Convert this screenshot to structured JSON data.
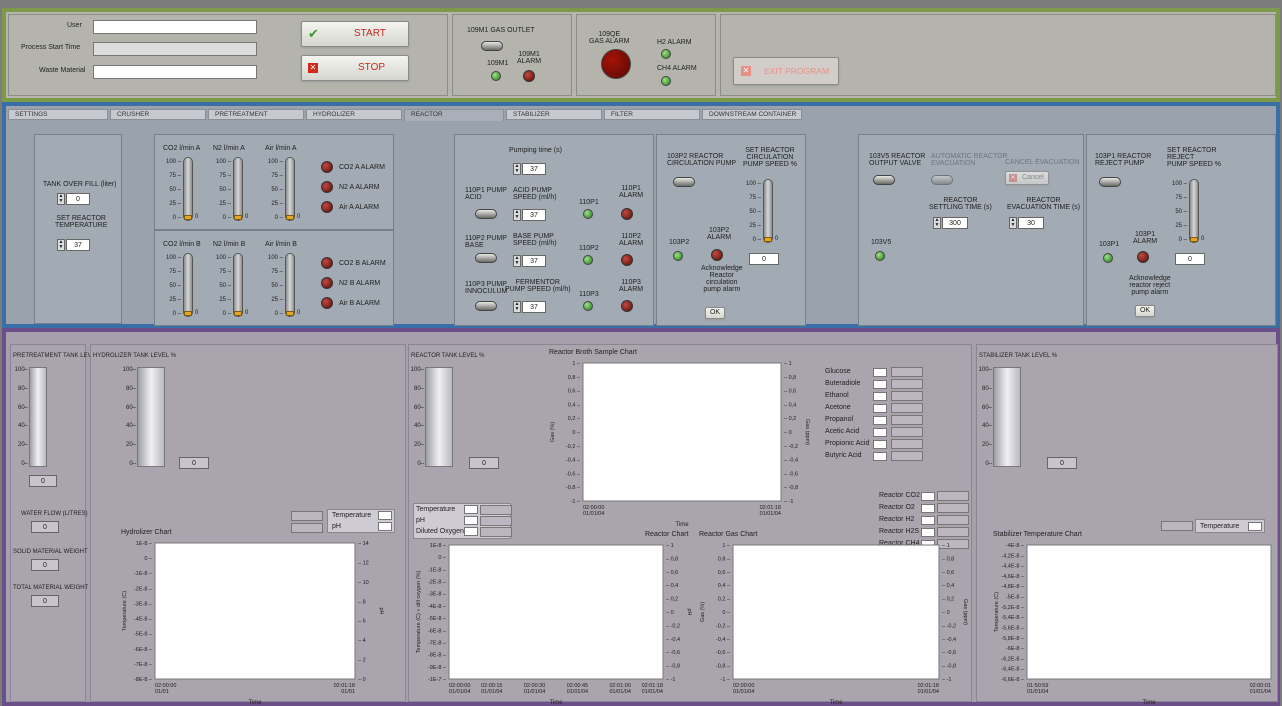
{
  "top": {
    "user_label": "User",
    "start_time_label": "Process Start Time",
    "waste_label": "Waste Material",
    "start": "START",
    "stop": "STOP",
    "gas_outlet": "109M1 GAS OUTLET",
    "m1": "109M1",
    "m1_alarm_a": "109M1",
    "m1_alarm_b": "ALARM",
    "qe_a": "109QE",
    "qe_b": "GAS ALARM",
    "h2_alarm": "H2 ALARM",
    "ch4_alarm": "CH4 ALARM",
    "exit": "EXIT PROGRAM"
  },
  "tabs": [
    "SETTINGS",
    "CRUSHER",
    "PRETREATMENT",
    "HYDROLIZER",
    "REACTOR",
    "STABILIZER",
    "FILTER",
    "DOWNSTREAM CONTAINER"
  ],
  "reactor": {
    "overfill_label": "TANK OVER FILL (liter)",
    "overfill": "0",
    "set_temp_a": "SET REACTOR",
    "set_temp_b": "TEMPERATURE",
    "set_temp": "37",
    "co2a": "CO2 l/min A",
    "n2a": "N2 l/min A",
    "aira": "Air l/min A",
    "co2b": "CO2 l/min B",
    "n2b": "N2 l/min B",
    "airb": "Air l/min B",
    "gauge_ticks": [
      "100",
      "75",
      "50",
      "25",
      "0"
    ],
    "gauge_zero": "0",
    "alarmsA": [
      "CO2 A ALARM",
      "N2 A ALARM",
      "Air A ALARM"
    ],
    "alarmsB": [
      "CO2 B ALARM",
      "N2 B ALARM",
      "Air B ALARM"
    ],
    "pumping_time": "Pumping time (s)",
    "pumping_val": "37",
    "p1_a": "110P1 PUMP",
    "p1_b": "ACID",
    "acid_a": "ACID PUMP",
    "acid_b": "SPEED (ml/h)",
    "acid_val": "37",
    "p1_led": "110P1",
    "p1_al_a": "110P1",
    "p1_al_b": "ALARM",
    "p2_a": "110P2 PUMP",
    "p2_b": "BASE",
    "base_a": "BASE PUMP",
    "base_b": "SPEED (ml/h)",
    "base_val": "37",
    "p2_led": "110P2",
    "p2_al_a": "110P2",
    "p2_al_b": "ALARM",
    "p3_a": "110P3 PUMP",
    "p3_b": "INNOCULUM",
    "ferm_a": "FERMENTOR",
    "ferm_b": "PUMP SPEED (ml/h)",
    "ferm_val": "37",
    "p3_led": "110P3",
    "p3_al_a": "110P3",
    "p3_al_b": "ALARM",
    "circ_a": "103P2 REACTOR",
    "circ_b": "CIRCULATION PUMP",
    "set_circ_a": "SET REACTOR",
    "set_circ_b": "CIRCULATION",
    "set_circ_c": "PUMP SPEED %",
    "circ_val": "0",
    "p2c_led": "103P2",
    "p2c_al_a": "103P2",
    "p2c_al_b": "ALARM",
    "ack_a": "Acknowledge",
    "ack_b": "Reactor",
    "ack_c": "circulation",
    "ack_d": "pump alarm",
    "ok": "OK",
    "v5_a": "103V5 REACTOR",
    "v5_b": "OUTPUT VALVE",
    "auto_a": "AUTOMATIC REACTOR",
    "auto_b": "EVACUATION",
    "cancel_evac": "CANCEL EVACUATION",
    "cancel": "Cancel",
    "settle_a": "REACTOR",
    "settle_b": "SETTLING TIME (s)",
    "settle_val": "300",
    "evac_a": "REACTOR",
    "evac_b": "EVACUATION TIME (s)",
    "evac_val": "30",
    "v5_led": "103V5",
    "rej_a": "103P1 REACTOR",
    "rej_b": "REJECT PUMP",
    "set_rej_a": "SET REACTOR",
    "set_rej_b": "REJECT",
    "set_rej_c": "PUMP SPEED %",
    "rej_val": "0",
    "p1r_led": "103P1",
    "p1r_al_a": "103P1",
    "p1r_al_b": "ALARM",
    "ack2_a": "Acknowledge",
    "ack2_b": "reactor reject",
    "ack2_c": "pump alarm",
    "ok2": "OK"
  },
  "bottom": {
    "pre_tank": "PRETREATMENT TANK LEVEL %",
    "hyd_tank": "HYDROLIZER TANK LEVEL %",
    "rea_tank": "REACTOR TANK LEVEL %",
    "sta_tank": "STABILIZER TANK LEVEL %",
    "tank_ticks": [
      "100",
      "80",
      "60",
      "40",
      "20",
      "0"
    ],
    "tank_val": "0",
    "water_flow": "WATER FLOW (LITRES)",
    "solid": "SOLID MATERIAL WEIGHT",
    "total": "TOTAL MATERIAL WEIGHT",
    "zero": "0",
    "hyd_chart": "Hydrolizer Chart",
    "leg_temp": "Temperature",
    "leg_ph": "pH",
    "rea_chart": "Reactor Chart",
    "leg_do": "Diluted Oxygen",
    "broth_chart": "Reactor Broth Sample Chart",
    "broth_legend": [
      "Glucose",
      "Buteradiole",
      "Ethanol",
      "Acetone",
      "Propanol",
      "Acetic Acid",
      "Propionic Acid",
      "Butyric Acid"
    ],
    "gas_legend": [
      "Reactor CO2",
      "Reactor O2",
      "Reactor H2",
      "Reactor H2S",
      "Reactor CH4"
    ],
    "gas_chart": "Reactor Gas Chart",
    "sta_chart": "Stabilizer Temperature Chart",
    "time": "Time"
  },
  "chart_data": [
    {
      "type": "line",
      "title": "Hydrolizer Chart",
      "xlabel": "Time",
      "ylabel": "Temperature (C)",
      "y2label": "pH",
      "x_ticks": [
        "02:00:00\n01/01",
        "02:01:18\n01/01"
      ],
      "y_ticks": [
        "1E-8",
        "0",
        "-1E-8",
        "-2E-8",
        "-3E-8",
        "-4E-8",
        "-5E-8",
        "-6E-8",
        "-7E-8",
        "-8E-8"
      ],
      "y2_ticks": [
        "14",
        "12",
        "10",
        "8",
        "6",
        "4",
        "2",
        "0"
      ],
      "series": []
    },
    {
      "type": "line",
      "title": "Reactor Broth Sample Chart",
      "xlabel": "Time",
      "ylabel": "Gas (%)",
      "y2label": "Gas (ppm)",
      "x_ticks": [
        "02:00:00\n01/01/04",
        "02:01:18\n01/01/04"
      ],
      "y_ticks": [
        "1",
        "0,8",
        "0,6",
        "0,4",
        "0,2",
        "0",
        "-0,2",
        "-0,4",
        "-0,6",
        "-0,8",
        "-1"
      ],
      "y2_ticks": [
        "1",
        "0,8",
        "0,6",
        "0,4",
        "0,2",
        "0",
        "-0,2",
        "-0,4",
        "-0,6",
        "-0,8",
        "-1"
      ],
      "series": []
    },
    {
      "type": "line",
      "title": "Reactor Chart",
      "xlabel": "Time",
      "ylabel": "Temperature (C) + dill oxygen (%)",
      "y2label": "pH",
      "x_ticks": [
        "02:00:00\n01/01/04",
        "02:00:15\n01/01/04",
        "02:00:30\n01/01/04",
        "02:00:45\n01/01/04",
        "02:01:00\n01/01/04",
        "02:01:18\n01/01/04"
      ],
      "y_ticks": [
        "1E-8",
        "0",
        "-1E-8",
        "-2E-8",
        "-3E-8",
        "-4E-8",
        "-5E-8",
        "-6E-8",
        "-7E-8",
        "-8E-8",
        "-9E-8",
        "-1E-7"
      ],
      "y2_ticks": [
        "1",
        "0,8",
        "0,6",
        "0,4",
        "0,2",
        "0",
        "-0,2",
        "-0,4",
        "-0,6",
        "-0,8",
        "-1"
      ],
      "series": []
    },
    {
      "type": "line",
      "title": "Reactor Gas Chart",
      "xlabel": "Time",
      "ylabel": "Gas (%)",
      "y2label": "Gas (ppm)",
      "x_ticks": [
        "02:00:00\n01/01/04",
        "02:01:18\n01/01/04"
      ],
      "y_ticks": [
        "1",
        "0,8",
        "0,6",
        "0,4",
        "0,2",
        "0",
        "-0,2",
        "-0,4",
        "-0,6",
        "-0,8",
        "-1"
      ],
      "y2_ticks": [
        "1",
        "0,8",
        "0,6",
        "0,4",
        "0,2",
        "0",
        "-0,2",
        "-0,4",
        "-0,6",
        "-0,8",
        "-1"
      ],
      "series": []
    },
    {
      "type": "line",
      "title": "Stabilizer Temperature Chart",
      "xlabel": "Time",
      "ylabel": "Temperature (C)",
      "x_ticks": [
        "01:50:59\n01/01/04",
        "02:00:01\n01/01/04"
      ],
      "y_ticks": [
        "-4E-8",
        "-4,2E-8",
        "-4,4E-8",
        "-4,6E-8",
        "-4,8E-8",
        "-5E-8",
        "-5,2E-8",
        "-5,4E-8",
        "-5,6E-8",
        "-5,8E-8",
        "-6E-8",
        "-6,2E-8",
        "-6,4E-8",
        "-6,6E-8"
      ],
      "series": []
    }
  ],
  "colors": {
    "top_border": "#7c9a4a",
    "mid_border": "#3a6ea8",
    "bot_border": "#6a4f8a",
    "led_green": "#2f9a1c",
    "led_red": "#6e0f0b"
  }
}
